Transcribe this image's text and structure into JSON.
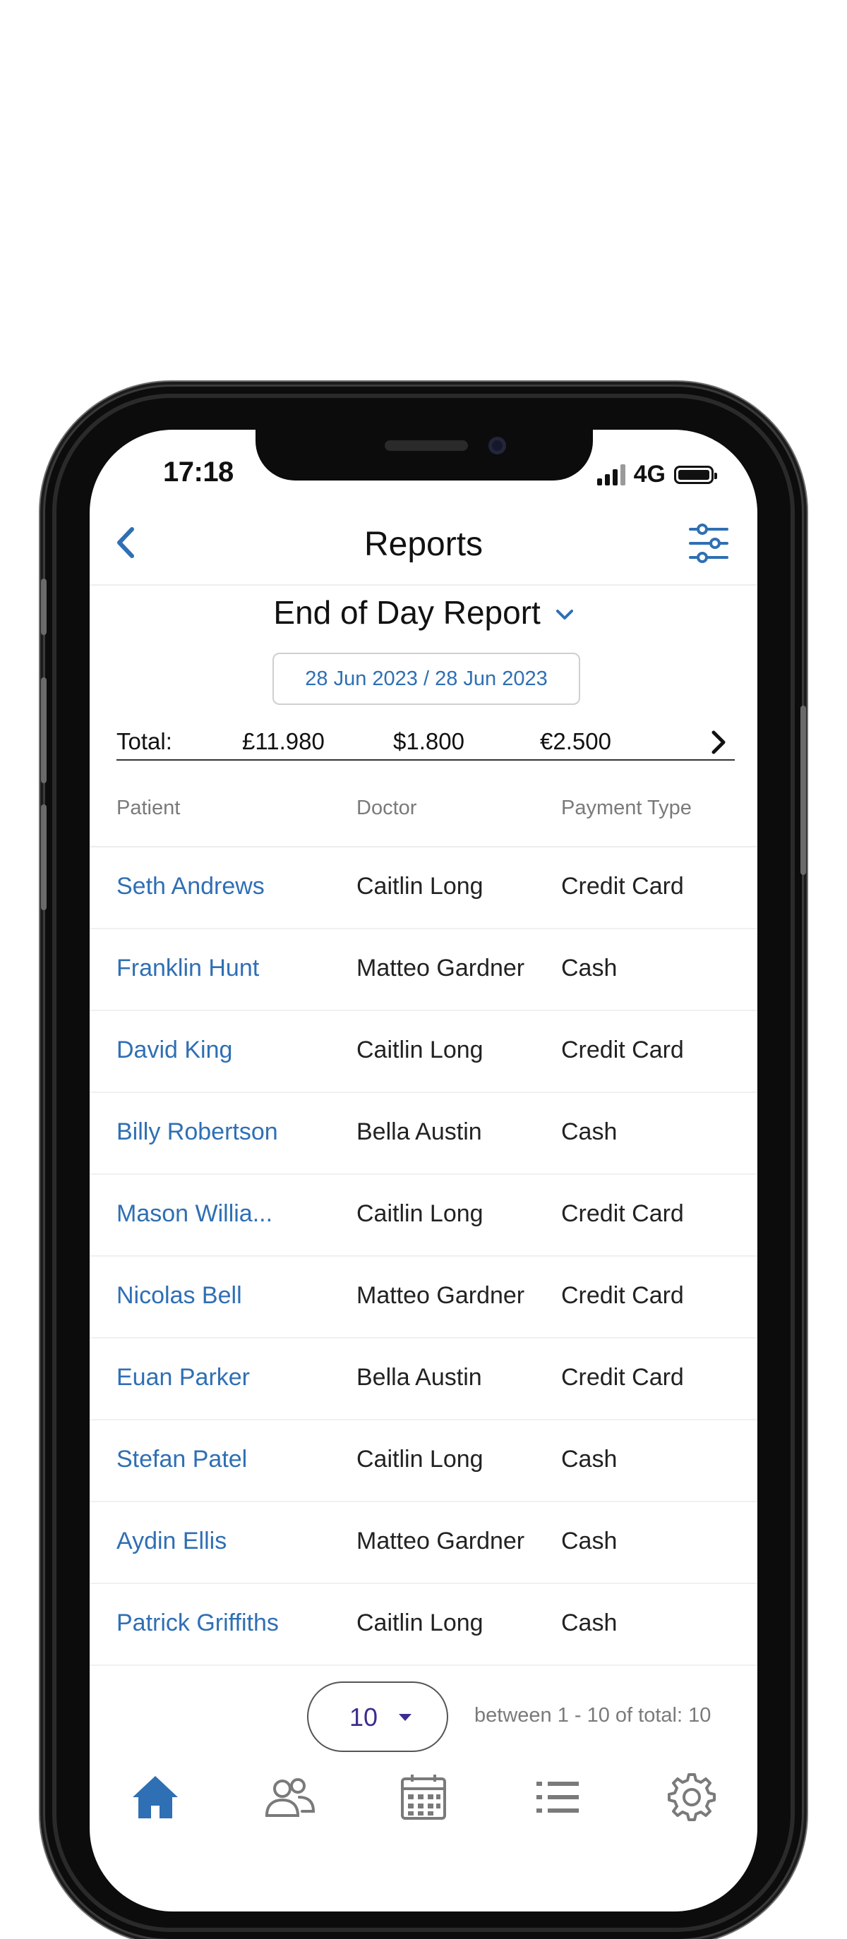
{
  "status_bar": {
    "time": "17:18",
    "network": "4G"
  },
  "nav": {
    "title": "Reports",
    "back_icon": "chevron-left-icon",
    "filter_icon": "sliders-icon"
  },
  "report": {
    "selected_report": "End of Day Report",
    "date_range": "28 Jun 2023 / 28 Jun 2023"
  },
  "totals": {
    "label": "Total:",
    "gbp": "£11.980",
    "usd": "$1.800",
    "eur": "€2.500"
  },
  "table": {
    "columns": [
      "Patient",
      "Doctor",
      "Payment Type"
    ],
    "rows": [
      {
        "patient": "Seth  Andrews",
        "doctor": "Caitlin  Long",
        "payment": "Credit Card"
      },
      {
        "patient": "Franklin  Hunt",
        "doctor": "Matteo Gardner",
        "payment": "Cash"
      },
      {
        "patient": "David King",
        "doctor": "Caitlin  Long",
        "payment": "Credit Card"
      },
      {
        "patient": "Billy  Robertson",
        "doctor": "Bella Austin",
        "payment": "Cash"
      },
      {
        "patient": "Mason  Willia...",
        "doctor": "Caitlin  Long",
        "payment": "Credit Card"
      },
      {
        "patient": "Nicolas  Bell",
        "doctor": "Matteo Gardner",
        "payment": "Credit Card"
      },
      {
        "patient": "Euan  Parker",
        "doctor": "Bella Austin",
        "payment": "Credit Card"
      },
      {
        "patient": "Stefan  Patel",
        "doctor": "Caitlin  Long",
        "payment": "Cash"
      },
      {
        "patient": "Aydin Ellis",
        "doctor": "Matteo Gardner",
        "payment": "Cash"
      },
      {
        "patient": "Patrick  Griffiths",
        "doctor": "Caitlin  Long",
        "payment": "Cash"
      }
    ]
  },
  "pagination": {
    "page_size": "10",
    "info": "between 1 - 10 of total: 10"
  },
  "tabbar": {
    "items": [
      "home-icon",
      "patients-icon",
      "calendar-icon",
      "list-icon",
      "settings-icon"
    ],
    "active": "home-icon"
  },
  "colors": {
    "accent": "#2f6fb4",
    "text": "#111111",
    "muted": "#7a7a7a",
    "page_size_text": "#3b2e8f"
  }
}
